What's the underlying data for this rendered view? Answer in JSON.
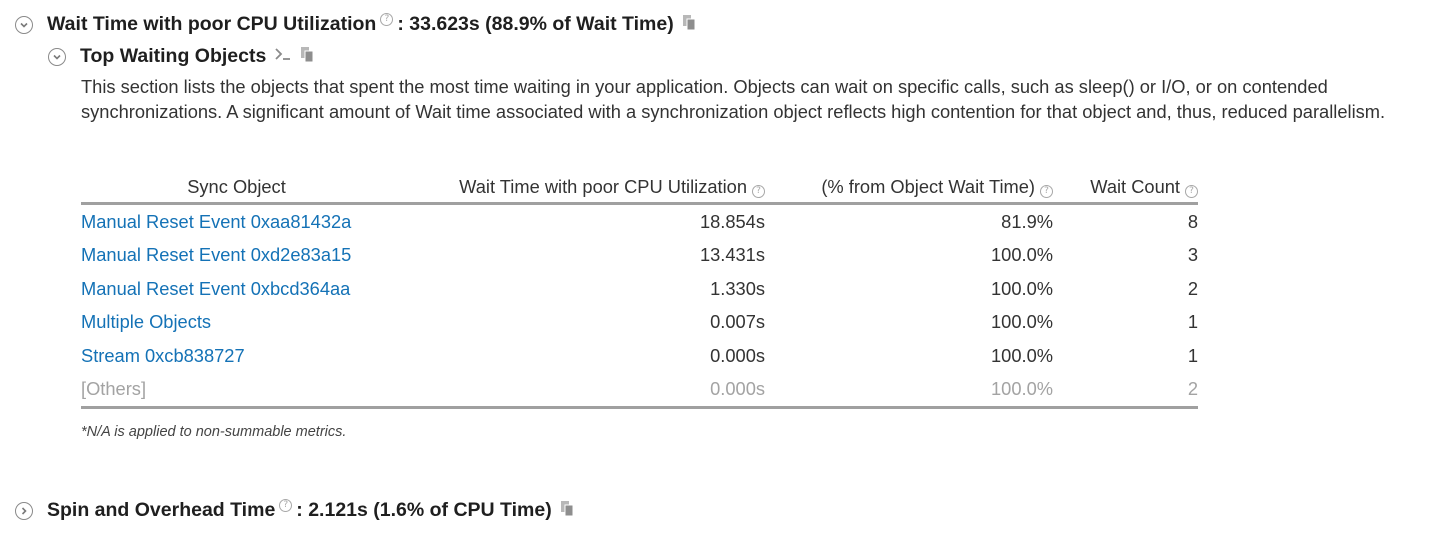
{
  "wait_section": {
    "title": "Wait Time with poor CPU Utilization",
    "value": ": 33.623s (88.9% of Wait Time)"
  },
  "top_objects": {
    "title": "Top Waiting Objects",
    "description": "This section lists the objects that spent the most time waiting in your application. Objects can wait on specific calls, such as sleep() or I/O, or on contended synchronizations. A significant amount of Wait time associated with a synchronization object reflects high contention for that object and, thus, reduced parallelism."
  },
  "table": {
    "headers": {
      "sync_object": "Sync Object",
      "wait_time": "Wait Time with poor CPU Utilization",
      "pct_object_wait": "(% from Object Wait Time)",
      "wait_count": "Wait Count"
    },
    "rows": [
      {
        "object": "Manual Reset Event 0xaa81432a",
        "wait_time": "18.854s",
        "pct": "81.9%",
        "count": "8"
      },
      {
        "object": "Manual Reset Event 0xd2e83a15",
        "wait_time": "13.431s",
        "pct": "100.0%",
        "count": "3"
      },
      {
        "object": "Manual Reset Event 0xbcd364aa",
        "wait_time": "1.330s",
        "pct": "100.0%",
        "count": "2"
      },
      {
        "object": "Multiple Objects",
        "wait_time": "0.007s",
        "pct": "100.0%",
        "count": "1"
      },
      {
        "object": "Stream 0xcb838727",
        "wait_time": "0.000s",
        "pct": "100.0%",
        "count": "1"
      },
      {
        "object": "[Others]",
        "wait_time": "0.000s",
        "pct": "100.0%",
        "count": "2"
      }
    ]
  },
  "footnote": "*N/A is applied to non-summable metrics.",
  "spin_section": {
    "title": "Spin and Overhead Time",
    "value": ": 2.121s (1.6% of CPU Time)"
  },
  "colors": {
    "link": "#1472b6",
    "muted": "#a3a3a3",
    "rule": "#a0a0a0"
  },
  "icons": {
    "expanded": "chevron-down-circle-icon",
    "collapsed": "chevron-right-circle-icon",
    "help": "question-circle-icon",
    "copy": "copy-icon",
    "command_line": "terminal-prompt-icon"
  }
}
